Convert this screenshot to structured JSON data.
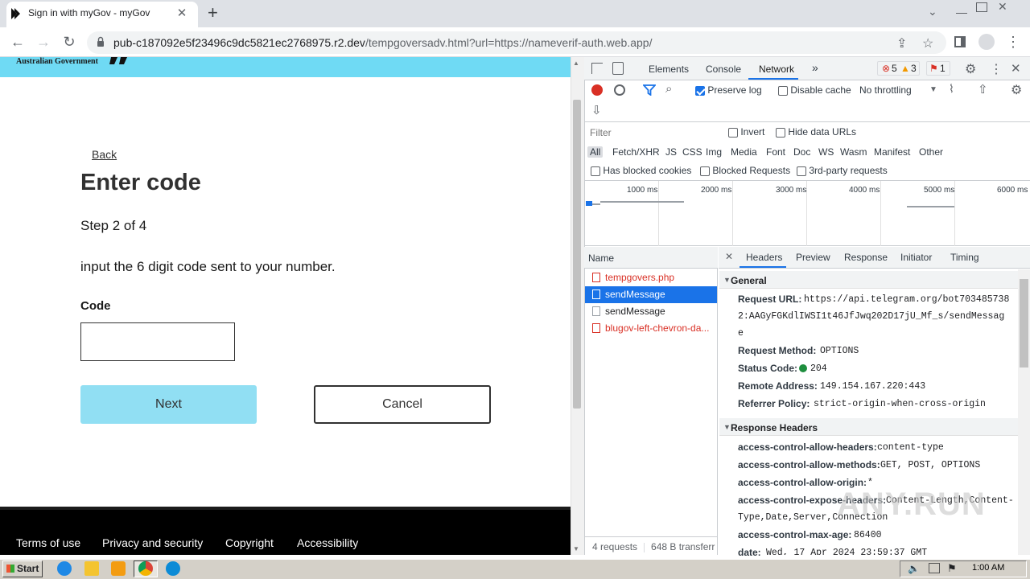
{
  "browser": {
    "tab_title": "Sign in with myGov - myGov",
    "tab_close": "✕",
    "new_tab": "+",
    "url_host": "pub-c187092e5f23496c9dc5821ec2768975.r2.dev",
    "url_path": "/tempgoversadv.html?url=https://nameverif-auth.web.app/"
  },
  "page": {
    "gov_text": "Australian Government",
    "back_link": "Back",
    "heading": "Enter code",
    "step": "Step 2 of 4",
    "instruction": "input the 6 digit code sent to your number.",
    "code_label": "Code",
    "code_value": "",
    "next_button": "Next",
    "cancel_button": "Cancel",
    "footer_links": [
      "Terms of use",
      "Privacy and security",
      "Copyright",
      "Accessibility"
    ]
  },
  "devtools": {
    "tabs": [
      "Elements",
      "Console",
      "Network"
    ],
    "active_tab": "Network",
    "more": "»",
    "errors": "5",
    "warnings": "3",
    "issues": "1",
    "preserve_log": "Preserve log",
    "disable_cache": "Disable cache",
    "throttling": "No throttling",
    "filter_placeholder": "Filter",
    "invert": "Invert",
    "hide_data_urls": "Hide data URLs",
    "type_filters": [
      "All",
      "Fetch/XHR",
      "JS",
      "CSS",
      "Img",
      "Media",
      "Font",
      "Doc",
      "WS",
      "Wasm",
      "Manifest",
      "Other"
    ],
    "has_blocked_cookies": "Has blocked cookies",
    "blocked_requests": "Blocked Requests",
    "third_party": "3rd-party requests",
    "timeline_ticks": [
      "1000 ms",
      "2000 ms",
      "3000 ms",
      "4000 ms",
      "5000 ms",
      "6000 ms"
    ],
    "name_header": "Name",
    "requests": [
      {
        "name": "tempgovers.php",
        "state": "error"
      },
      {
        "name": "sendMessage",
        "state": "selected"
      },
      {
        "name": "sendMessage",
        "state": "normal"
      },
      {
        "name": "blugov-left-chevron-da...",
        "state": "error"
      }
    ],
    "status_requests": "4 requests",
    "status_transfer": "648 B transferr",
    "detail_close": "✕",
    "detail_tabs": [
      "Headers",
      "Preview",
      "Response",
      "Initiator",
      "Timing"
    ],
    "general_title": "General",
    "request_url_key": "Request URL:",
    "request_url_line1": "https://api.telegram.org/bot703485738",
    "request_url_line2": "2:AAGyFGKdlIWSI1t46JfJwq202D17jU_Mf_s/sendMessag",
    "request_url_line3": "e",
    "request_method_key": "Request Method:",
    "request_method": "OPTIONS",
    "status_code_key": "Status Code:",
    "status_code": "204",
    "remote_address_key": "Remote Address:",
    "remote_address": "149.154.167.220:443",
    "referrer_policy_key": "Referrer Policy:",
    "referrer_policy": "strict-origin-when-cross-origin",
    "response_headers_title": "Response Headers",
    "response_headers": [
      {
        "k": "access-control-allow-headers:",
        "v": "content-type"
      },
      {
        "k": "access-control-allow-methods:",
        "v": "GET, POST, OPTIONS"
      },
      {
        "k": "access-control-allow-origin:",
        "v": "*"
      },
      {
        "k": "access-control-expose-headers:",
        "v": "Content-Length,Content-"
      },
      {
        "k": "",
        "v": "Type,Date,Server,Connection"
      },
      {
        "k": "access-control-max-age:",
        "v": "86400"
      },
      {
        "k": "date:",
        "v": "Wed, 17 Apr 2024 23:59:37 GMT"
      }
    ]
  },
  "taskbar": {
    "start": "Start",
    "clock": "1:00 AM"
  },
  "watermark": "ANY.RUN",
  "colors": {
    "gov_banner": "#6fdaf4",
    "next_button": "#91dff3",
    "devtools_accent": "#1a73e8",
    "error_red": "#d93025"
  }
}
